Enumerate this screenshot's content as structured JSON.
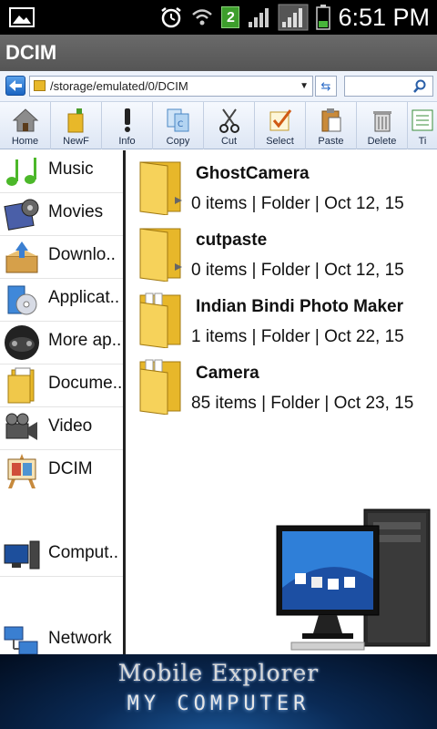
{
  "status_bar": {
    "time": "6:51 PM",
    "notification_badge": "2",
    "icons": [
      "gallery-icon",
      "alarm-icon",
      "wifi-icon",
      "signal-icon",
      "battery-icon"
    ]
  },
  "window": {
    "title": "DCIM"
  },
  "address_bar": {
    "path": "/storage/emulated/0/DCIM"
  },
  "toolbar": {
    "items": [
      {
        "label": "Home",
        "icon": "home-icon"
      },
      {
        "label": "NewF",
        "icon": "new-folder-icon"
      },
      {
        "label": "Info",
        "icon": "info-icon"
      },
      {
        "label": "Copy",
        "icon": "copy-icon"
      },
      {
        "label": "Cut",
        "icon": "scissors-icon"
      },
      {
        "label": "Select",
        "icon": "checkbox-icon"
      },
      {
        "label": "Paste",
        "icon": "paste-icon"
      },
      {
        "label": "Delete",
        "icon": "trash-icon"
      },
      {
        "label": "Ti",
        "icon": "tile-view-icon"
      }
    ]
  },
  "sidebar": {
    "items": [
      {
        "label": "Music",
        "icon": "music-icon"
      },
      {
        "label": "Movies",
        "icon": "movies-icon"
      },
      {
        "label": "Downlo..",
        "icon": "downloads-icon"
      },
      {
        "label": "Applicat..",
        "icon": "applications-icon"
      },
      {
        "label": "More ap..",
        "icon": "gamepad-icon"
      },
      {
        "label": "Docume..",
        "icon": "documents-icon"
      },
      {
        "label": "Video",
        "icon": "video-camera-icon"
      },
      {
        "label": "DCIM",
        "icon": "dcim-icon"
      },
      {
        "label": "Comput..",
        "icon": "computer-icon"
      },
      {
        "label": "Network",
        "icon": "network-icon"
      }
    ]
  },
  "files": [
    {
      "name": "GhostCamera",
      "meta": "0 items | Folder | Oct 12, 15",
      "icon": "empty-folder-icon"
    },
    {
      "name": "cutpaste",
      "meta": "0 items | Folder | Oct 12, 15",
      "icon": "empty-folder-icon"
    },
    {
      "name": "Indian Bindi Photo Maker",
      "meta": "1 items | Folder | Oct 22, 15",
      "icon": "full-folder-icon"
    },
    {
      "name": "Camera",
      "meta": "85 items | Folder | Oct 23, 15",
      "icon": "full-folder-icon"
    }
  ],
  "banner": {
    "title": "Mobile Explorer",
    "subtitle": "MY COMPUTER"
  }
}
